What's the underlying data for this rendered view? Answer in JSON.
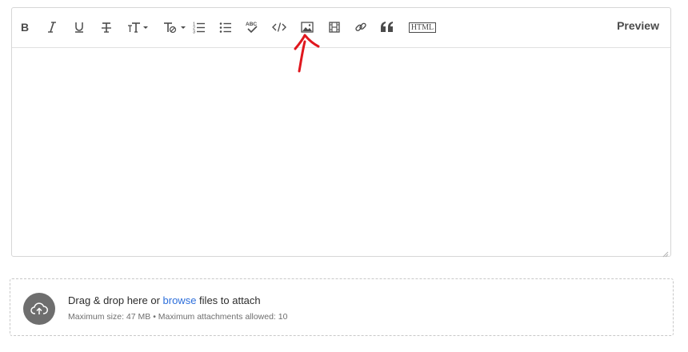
{
  "toolbar": {
    "buttons": [
      {
        "name": "bold-button",
        "icon": "bold-icon"
      },
      {
        "name": "italic-button",
        "icon": "italic-icon"
      },
      {
        "name": "underline-button",
        "icon": "underline-icon"
      },
      {
        "name": "strikethrough-button",
        "icon": "strikethrough-icon"
      },
      {
        "name": "text-size-dropdown",
        "icon": "text-size-icon"
      },
      {
        "name": "text-style-dropdown",
        "icon": "text-format-icon"
      },
      {
        "name": "ordered-list-button",
        "icon": "numbered-list-icon"
      },
      {
        "name": "bulleted-list-button",
        "icon": "bulleted-list-icon"
      },
      {
        "name": "spellcheck-button",
        "icon": "spellcheck-icon"
      },
      {
        "name": "code-button",
        "icon": "code-icon"
      },
      {
        "name": "insert-image-button",
        "icon": "image-icon"
      },
      {
        "name": "insert-video-button",
        "icon": "film-icon"
      },
      {
        "name": "insert-link-button",
        "icon": "link-icon"
      },
      {
        "name": "blockquote-button",
        "icon": "quote-icon"
      },
      {
        "name": "html-source-button",
        "icon": "html-icon"
      }
    ],
    "preview_label": "Preview",
    "html_label": "HTML"
  },
  "annotation": {
    "color": "#e0171e",
    "points_to": "insert-image-button"
  },
  "dropzone": {
    "text_before": "Drag & drop here or ",
    "link_label": "browse",
    "text_after": " files to attach",
    "hint": "Maximum size: 47 MB • Maximum attachments allowed: 10",
    "icon": "cloud-upload-icon"
  },
  "colors": {
    "link": "#2d6fdb",
    "annotation": "#e0171e",
    "upload_circle": "#6e6e6e"
  }
}
